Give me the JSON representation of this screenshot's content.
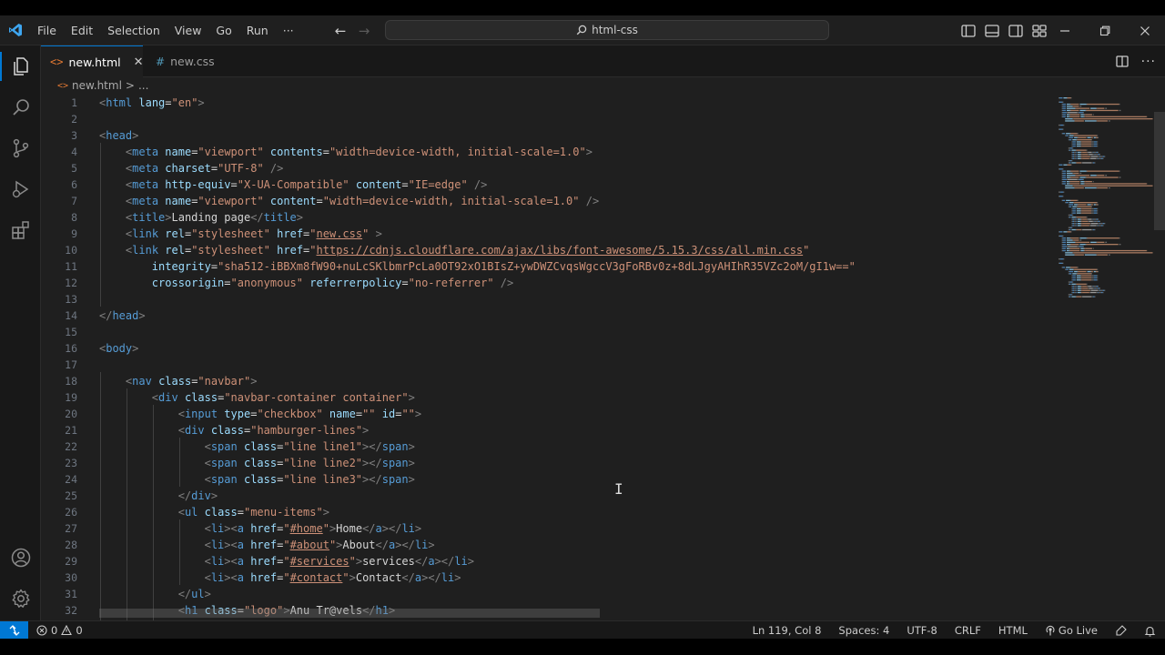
{
  "window": {
    "search_text": "html-css"
  },
  "menu": {
    "items": [
      "File",
      "Edit",
      "Selection",
      "View",
      "Go",
      "Run",
      "···"
    ]
  },
  "tabs": [
    {
      "label": "new.html",
      "icon": "html-file-icon",
      "active": true
    },
    {
      "label": "new.css",
      "icon": "css-file-icon",
      "active": false
    }
  ],
  "breadcrumb": {
    "file": "new.html",
    "separator": ">",
    "rest": "..."
  },
  "editor": {
    "line_numbers": [
      "1",
      "2",
      "3",
      "4",
      "5",
      "6",
      "7",
      "8",
      "9",
      "10",
      "11",
      "12",
      "13",
      "14",
      "15",
      "16",
      "17",
      "18",
      "19",
      "20",
      "21",
      "22",
      "23",
      "24",
      "25",
      "26",
      "27",
      "28",
      "29",
      "30",
      "31",
      "32"
    ],
    "lines": [
      [
        [
          "br",
          "<"
        ],
        [
          "tag",
          "html"
        ],
        [
          "txt",
          " "
        ],
        [
          "attr",
          "lang"
        ],
        [
          "txt",
          "="
        ],
        [
          "str",
          "\"en\""
        ],
        [
          "br",
          ">"
        ]
      ],
      [],
      [
        [
          "br",
          "<"
        ],
        [
          "tag",
          "head"
        ],
        [
          "br",
          ">"
        ]
      ],
      [
        [
          "txt",
          "    "
        ],
        [
          "br",
          "<"
        ],
        [
          "tag",
          "meta"
        ],
        [
          "txt",
          " "
        ],
        [
          "attr",
          "name"
        ],
        [
          "txt",
          "="
        ],
        [
          "str",
          "\"viewport\""
        ],
        [
          "txt",
          " "
        ],
        [
          "attr",
          "contents"
        ],
        [
          "txt",
          "="
        ],
        [
          "str",
          "\"width=device-width, initial-scale=1.0\""
        ],
        [
          "br",
          ">"
        ]
      ],
      [
        [
          "txt",
          "    "
        ],
        [
          "br",
          "<"
        ],
        [
          "tag",
          "meta"
        ],
        [
          "txt",
          " "
        ],
        [
          "attr",
          "charset"
        ],
        [
          "txt",
          "="
        ],
        [
          "str",
          "\"UTF-8\""
        ],
        [
          "txt",
          " "
        ],
        [
          "br",
          "/>"
        ]
      ],
      [
        [
          "txt",
          "    "
        ],
        [
          "br",
          "<"
        ],
        [
          "tag",
          "meta"
        ],
        [
          "txt",
          " "
        ],
        [
          "attr",
          "http-equiv"
        ],
        [
          "txt",
          "="
        ],
        [
          "str",
          "\"X-UA-Compatible\""
        ],
        [
          "txt",
          " "
        ],
        [
          "attr",
          "content"
        ],
        [
          "txt",
          "="
        ],
        [
          "str",
          "\"IE=edge\""
        ],
        [
          "txt",
          " "
        ],
        [
          "br",
          "/>"
        ]
      ],
      [
        [
          "txt",
          "    "
        ],
        [
          "br",
          "<"
        ],
        [
          "tag",
          "meta"
        ],
        [
          "txt",
          " "
        ],
        [
          "attr",
          "name"
        ],
        [
          "txt",
          "="
        ],
        [
          "str",
          "\"viewport\""
        ],
        [
          "txt",
          " "
        ],
        [
          "attr",
          "content"
        ],
        [
          "txt",
          "="
        ],
        [
          "str",
          "\"width=device-width, initial-scale=1.0\""
        ],
        [
          "txt",
          " "
        ],
        [
          "br",
          "/>"
        ]
      ],
      [
        [
          "txt",
          "    "
        ],
        [
          "br",
          "<"
        ],
        [
          "tag",
          "title"
        ],
        [
          "br",
          ">"
        ],
        [
          "txt",
          "Landing page"
        ],
        [
          "br",
          "</"
        ],
        [
          "tag",
          "title"
        ],
        [
          "br",
          ">"
        ]
      ],
      [
        [
          "txt",
          "    "
        ],
        [
          "br",
          "<"
        ],
        [
          "tag",
          "link"
        ],
        [
          "txt",
          " "
        ],
        [
          "attr",
          "rel"
        ],
        [
          "txt",
          "="
        ],
        [
          "str",
          "\"stylesheet\""
        ],
        [
          "txt",
          " "
        ],
        [
          "attr",
          "href"
        ],
        [
          "txt",
          "="
        ],
        [
          "str",
          "\""
        ],
        [
          "stru",
          "new.css"
        ],
        [
          "str",
          "\""
        ],
        [
          "txt",
          " "
        ],
        [
          "br",
          ">"
        ]
      ],
      [
        [
          "txt",
          "    "
        ],
        [
          "br",
          "<"
        ],
        [
          "tag",
          "link"
        ],
        [
          "txt",
          " "
        ],
        [
          "attr",
          "rel"
        ],
        [
          "txt",
          "="
        ],
        [
          "str",
          "\"stylesheet\""
        ],
        [
          "txt",
          " "
        ],
        [
          "attr",
          "href"
        ],
        [
          "txt",
          "="
        ],
        [
          "str",
          "\""
        ],
        [
          "stru",
          "https://cdnjs.cloudflare.com/ajax/libs/font-awesome/5.15.3/css/all.min.css"
        ],
        [
          "str",
          "\""
        ]
      ],
      [
        [
          "txt",
          "        "
        ],
        [
          "attr",
          "integrity"
        ],
        [
          "txt",
          "="
        ],
        [
          "str",
          "\"sha512-iBBXm8fW90+nuLcSKlbmrPcLa0OT92xO1BIsZ+ywDWZCvqsWgccV3gFoRBv0z+8dLJgyAHIhR35VZc2oM/gI1w==\""
        ]
      ],
      [
        [
          "txt",
          "        "
        ],
        [
          "attr",
          "crossorigin"
        ],
        [
          "txt",
          "="
        ],
        [
          "str",
          "\"anonymous\""
        ],
        [
          "txt",
          " "
        ],
        [
          "attr",
          "referrerpolicy"
        ],
        [
          "txt",
          "="
        ],
        [
          "str",
          "\"no-referrer\""
        ],
        [
          "txt",
          " "
        ],
        [
          "br",
          "/>"
        ]
      ],
      [],
      [
        [
          "br",
          "</"
        ],
        [
          "tag",
          "head"
        ],
        [
          "br",
          ">"
        ]
      ],
      [],
      [
        [
          "br",
          "<"
        ],
        [
          "tag",
          "body"
        ],
        [
          "br",
          ">"
        ]
      ],
      [],
      [
        [
          "txt",
          "    "
        ],
        [
          "br",
          "<"
        ],
        [
          "tag",
          "nav"
        ],
        [
          "txt",
          " "
        ],
        [
          "attr",
          "class"
        ],
        [
          "txt",
          "="
        ],
        [
          "str",
          "\"navbar\""
        ],
        [
          "br",
          ">"
        ]
      ],
      [
        [
          "txt",
          "        "
        ],
        [
          "br",
          "<"
        ],
        [
          "tag",
          "div"
        ],
        [
          "txt",
          " "
        ],
        [
          "attr",
          "class"
        ],
        [
          "txt",
          "="
        ],
        [
          "str",
          "\"navbar-container container\""
        ],
        [
          "br",
          ">"
        ]
      ],
      [
        [
          "txt",
          "            "
        ],
        [
          "br",
          "<"
        ],
        [
          "tag",
          "input"
        ],
        [
          "txt",
          " "
        ],
        [
          "attr",
          "type"
        ],
        [
          "txt",
          "="
        ],
        [
          "str",
          "\"checkbox\""
        ],
        [
          "txt",
          " "
        ],
        [
          "attr",
          "name"
        ],
        [
          "txt",
          "="
        ],
        [
          "str",
          "\"\""
        ],
        [
          "txt",
          " "
        ],
        [
          "attr",
          "id"
        ],
        [
          "txt",
          "="
        ],
        [
          "str",
          "\"\""
        ],
        [
          "br",
          ">"
        ]
      ],
      [
        [
          "txt",
          "            "
        ],
        [
          "br",
          "<"
        ],
        [
          "tag",
          "div"
        ],
        [
          "txt",
          " "
        ],
        [
          "attr",
          "class"
        ],
        [
          "txt",
          "="
        ],
        [
          "str",
          "\"hamburger-lines\""
        ],
        [
          "br",
          ">"
        ]
      ],
      [
        [
          "txt",
          "                "
        ],
        [
          "br",
          "<"
        ],
        [
          "tag",
          "span"
        ],
        [
          "txt",
          " "
        ],
        [
          "attr",
          "class"
        ],
        [
          "txt",
          "="
        ],
        [
          "str",
          "\"line line1\""
        ],
        [
          "br",
          "></"
        ],
        [
          "tag",
          "span"
        ],
        [
          "br",
          ">"
        ]
      ],
      [
        [
          "txt",
          "                "
        ],
        [
          "br",
          "<"
        ],
        [
          "tag",
          "span"
        ],
        [
          "txt",
          " "
        ],
        [
          "attr",
          "class"
        ],
        [
          "txt",
          "="
        ],
        [
          "str",
          "\"line line2\""
        ],
        [
          "br",
          "></"
        ],
        [
          "tag",
          "span"
        ],
        [
          "br",
          ">"
        ]
      ],
      [
        [
          "txt",
          "                "
        ],
        [
          "br",
          "<"
        ],
        [
          "tag",
          "span"
        ],
        [
          "txt",
          " "
        ],
        [
          "attr",
          "class"
        ],
        [
          "txt",
          "="
        ],
        [
          "str",
          "\"line line3\""
        ],
        [
          "br",
          "></"
        ],
        [
          "tag",
          "span"
        ],
        [
          "br",
          ">"
        ]
      ],
      [
        [
          "txt",
          "            "
        ],
        [
          "br",
          "</"
        ],
        [
          "tag",
          "div"
        ],
        [
          "br",
          ">"
        ]
      ],
      [
        [
          "txt",
          "            "
        ],
        [
          "br",
          "<"
        ],
        [
          "tag",
          "ul"
        ],
        [
          "txt",
          " "
        ],
        [
          "attr",
          "class"
        ],
        [
          "txt",
          "="
        ],
        [
          "str",
          "\"menu-items\""
        ],
        [
          "br",
          ">"
        ]
      ],
      [
        [
          "txt",
          "                "
        ],
        [
          "br",
          "<"
        ],
        [
          "tag",
          "li"
        ],
        [
          "br",
          "><"
        ],
        [
          "tag",
          "a"
        ],
        [
          "txt",
          " "
        ],
        [
          "attr",
          "href"
        ],
        [
          "txt",
          "="
        ],
        [
          "str",
          "\""
        ],
        [
          "stru",
          "#home"
        ],
        [
          "str",
          "\""
        ],
        [
          "br",
          ">"
        ],
        [
          "txt",
          "Home"
        ],
        [
          "br",
          "</"
        ],
        [
          "tag",
          "a"
        ],
        [
          "br",
          "></"
        ],
        [
          "tag",
          "li"
        ],
        [
          "br",
          ">"
        ]
      ],
      [
        [
          "txt",
          "                "
        ],
        [
          "br",
          "<"
        ],
        [
          "tag",
          "li"
        ],
        [
          "br",
          "><"
        ],
        [
          "tag",
          "a"
        ],
        [
          "txt",
          " "
        ],
        [
          "attr",
          "href"
        ],
        [
          "txt",
          "="
        ],
        [
          "str",
          "\""
        ],
        [
          "stru",
          "#about"
        ],
        [
          "str",
          "\""
        ],
        [
          "br",
          ">"
        ],
        [
          "txt",
          "About"
        ],
        [
          "br",
          "</"
        ],
        [
          "tag",
          "a"
        ],
        [
          "br",
          "></"
        ],
        [
          "tag",
          "li"
        ],
        [
          "br",
          ">"
        ]
      ],
      [
        [
          "txt",
          "                "
        ],
        [
          "br",
          "<"
        ],
        [
          "tag",
          "li"
        ],
        [
          "br",
          "><"
        ],
        [
          "tag",
          "a"
        ],
        [
          "txt",
          " "
        ],
        [
          "attr",
          "href"
        ],
        [
          "txt",
          "="
        ],
        [
          "str",
          "\""
        ],
        [
          "stru",
          "#services"
        ],
        [
          "str",
          "\""
        ],
        [
          "br",
          ">"
        ],
        [
          "txt",
          "services"
        ],
        [
          "br",
          "</"
        ],
        [
          "tag",
          "a"
        ],
        [
          "br",
          "></"
        ],
        [
          "tag",
          "li"
        ],
        [
          "br",
          ">"
        ]
      ],
      [
        [
          "txt",
          "                "
        ],
        [
          "br",
          "<"
        ],
        [
          "tag",
          "li"
        ],
        [
          "br",
          "><"
        ],
        [
          "tag",
          "a"
        ],
        [
          "txt",
          " "
        ],
        [
          "attr",
          "href"
        ],
        [
          "txt",
          "="
        ],
        [
          "str",
          "\""
        ],
        [
          "stru",
          "#contact"
        ],
        [
          "str",
          "\""
        ],
        [
          "br",
          ">"
        ],
        [
          "txt",
          "Contact"
        ],
        [
          "br",
          "</"
        ],
        [
          "tag",
          "a"
        ],
        [
          "br",
          "></"
        ],
        [
          "tag",
          "li"
        ],
        [
          "br",
          ">"
        ]
      ],
      [
        [
          "txt",
          "            "
        ],
        [
          "br",
          "</"
        ],
        [
          "tag",
          "ul"
        ],
        [
          "br",
          ">"
        ]
      ],
      [
        [
          "txt",
          "            "
        ],
        [
          "br",
          "<"
        ],
        [
          "tag",
          "h1"
        ],
        [
          "txt",
          " "
        ],
        [
          "attr",
          "class"
        ],
        [
          "txt",
          "="
        ],
        [
          "str",
          "\"logo\""
        ],
        [
          "br",
          ">"
        ],
        [
          "txt",
          "Anu Tr@vels"
        ],
        [
          "br",
          "</"
        ],
        [
          "tag",
          "h1"
        ],
        [
          "br",
          ">"
        ]
      ]
    ]
  },
  "statusbar": {
    "errors": "0",
    "warnings": "0",
    "position": "Ln 119, Col 8",
    "spaces": "Spaces: 4",
    "encoding": "UTF-8",
    "eol": "CRLF",
    "language": "HTML",
    "golive": "Go Live"
  },
  "colors": {
    "accent": "#0078d4",
    "tag": "#569cd6",
    "attr": "#9cdcfe",
    "string": "#ce9178",
    "bracket": "#808080"
  }
}
